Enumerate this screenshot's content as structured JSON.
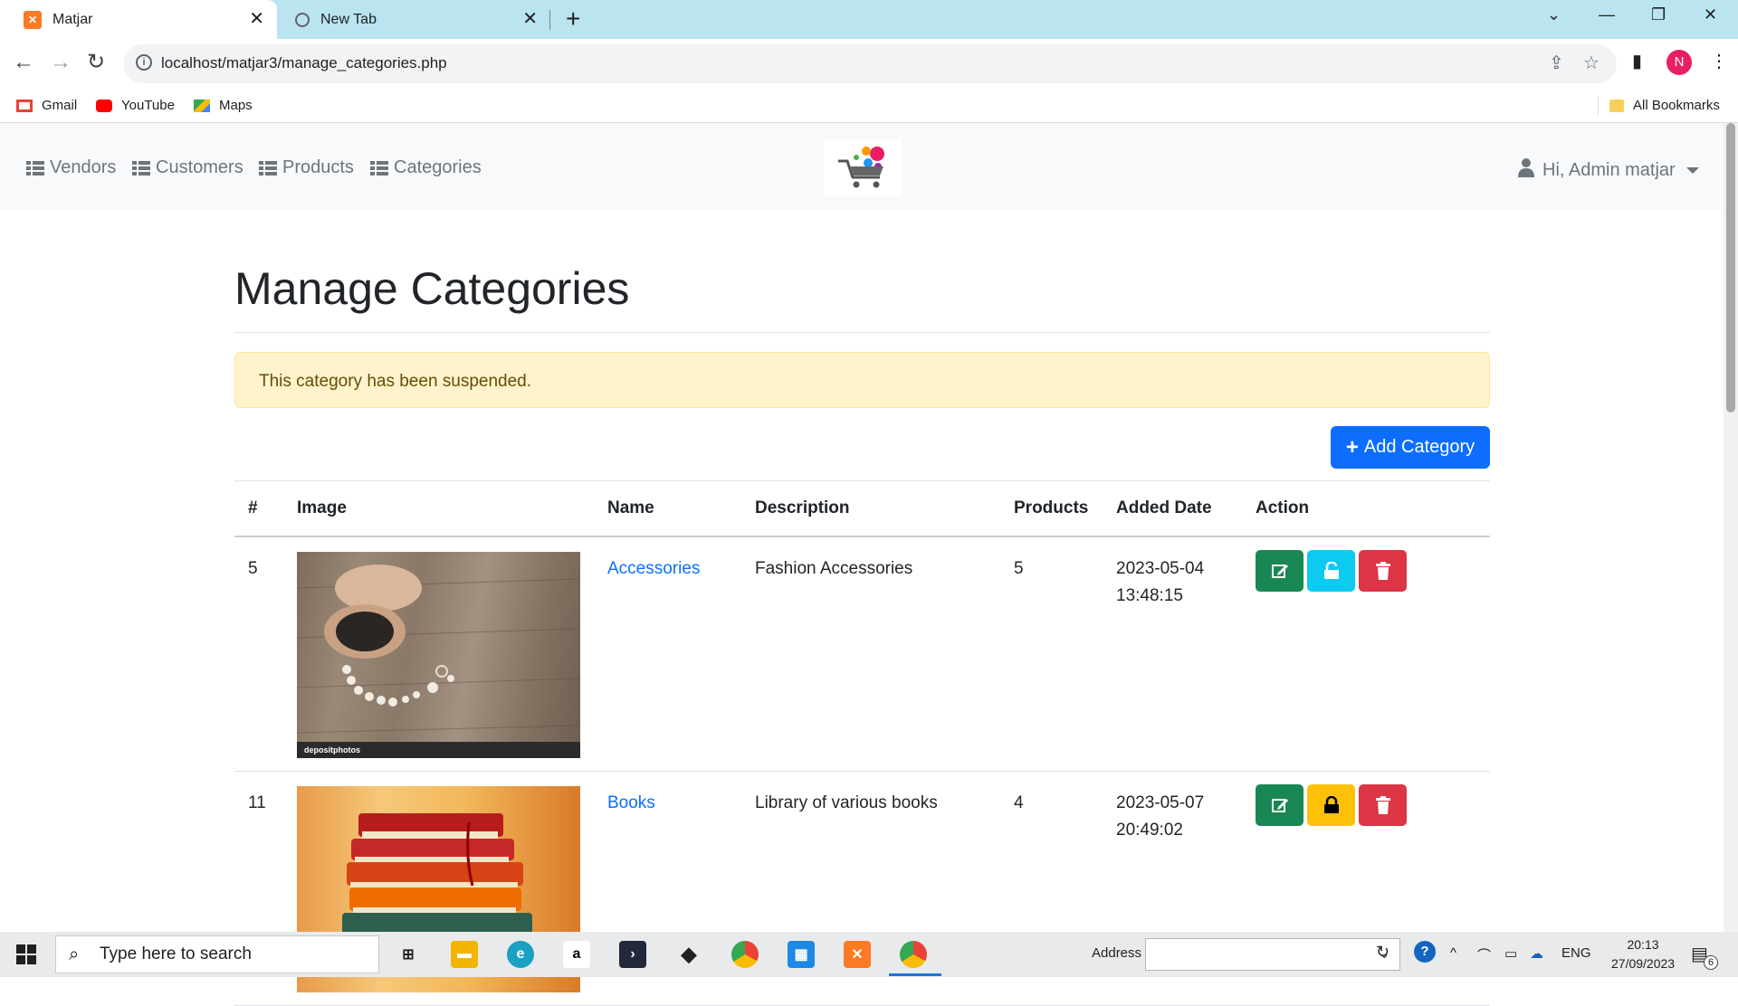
{
  "browser": {
    "tabs": [
      {
        "title": "Matjar",
        "active": true
      },
      {
        "title": "New Tab",
        "active": false
      }
    ],
    "url": "localhost/matjar3/manage_categories.php",
    "profile_initial": "N",
    "bookmarks": [
      {
        "label": "Gmail",
        "icon": "gmail-icon"
      },
      {
        "label": "YouTube",
        "icon": "youtube-icon"
      },
      {
        "label": "Maps",
        "icon": "maps-icon"
      }
    ],
    "all_bookmarks": "All Bookmarks"
  },
  "site_nav": {
    "links": [
      "Vendors",
      "Customers",
      "Products",
      "Categories"
    ],
    "user_menu": "Hi, Admin matjar"
  },
  "page": {
    "title": "Manage Categories",
    "alert": "This category has been suspended.",
    "add_button": "Add Category"
  },
  "table": {
    "headers": [
      "#",
      "Image",
      "Name",
      "Description",
      "Products",
      "Added Date",
      "Action"
    ],
    "rows": [
      {
        "id": "5",
        "name": "Accessories",
        "description": "Fashion Accessories",
        "products": "5",
        "date": "2023-05-04",
        "time": "13:48:15",
        "status": "active",
        "watermark": "depositphotos"
      },
      {
        "id": "11",
        "name": "Books",
        "description": "Library of various books",
        "products": "4",
        "date": "2023-05-07",
        "time": "20:49:02",
        "status": "suspended"
      }
    ]
  },
  "taskbar": {
    "search_placeholder": "Type here to search",
    "address_label": "Address",
    "language": "ENG",
    "time": "20:13",
    "date": "27/09/2023",
    "notification_count": "6"
  },
  "colors": {
    "primary": "#0d6efd",
    "success": "#198754",
    "info": "#0dcaf0",
    "warning": "#ffc107",
    "danger": "#dc3545",
    "alert_bg": "#fff3cd",
    "tab_strip": "#b9e4f0"
  }
}
